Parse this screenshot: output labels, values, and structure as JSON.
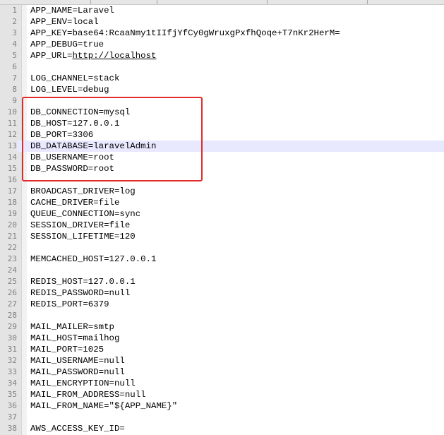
{
  "editor": {
    "lines": [
      {
        "num": "1",
        "text": "APP_NAME=Laravel"
      },
      {
        "num": "2",
        "text": "APP_ENV=local"
      },
      {
        "num": "3",
        "text": "APP_KEY=base64:RcaaNmy1tIIfjYfCy0gWruxgPxfhQoqe+T7nKr2HerM="
      },
      {
        "num": "4",
        "text": "APP_DEBUG=true"
      },
      {
        "num": "5",
        "text": "APP_URL=",
        "link": "http://localhost"
      },
      {
        "num": "6",
        "text": ""
      },
      {
        "num": "7",
        "text": "LOG_CHANNEL=stack"
      },
      {
        "num": "8",
        "text": "LOG_LEVEL=debug"
      },
      {
        "num": "9",
        "text": ""
      },
      {
        "num": "10",
        "text": "DB_CONNECTION=mysql"
      },
      {
        "num": "11",
        "text": "DB_HOST=127.0.0.1"
      },
      {
        "num": "12",
        "text": "DB_PORT=3306"
      },
      {
        "num": "13",
        "text": "DB_DATABASE=laravelAdmin",
        "current": true
      },
      {
        "num": "14",
        "text": "DB_USERNAME=root"
      },
      {
        "num": "15",
        "text": "DB_PASSWORD=root"
      },
      {
        "num": "16",
        "text": ""
      },
      {
        "num": "17",
        "text": "BROADCAST_DRIVER=log"
      },
      {
        "num": "18",
        "text": "CACHE_DRIVER=file"
      },
      {
        "num": "19",
        "text": "QUEUE_CONNECTION=sync"
      },
      {
        "num": "20",
        "text": "SESSION_DRIVER=file"
      },
      {
        "num": "21",
        "text": "SESSION_LIFETIME=120"
      },
      {
        "num": "22",
        "text": ""
      },
      {
        "num": "23",
        "text": "MEMCACHED_HOST=127.0.0.1"
      },
      {
        "num": "24",
        "text": ""
      },
      {
        "num": "25",
        "text": "REDIS_HOST=127.0.0.1"
      },
      {
        "num": "26",
        "text": "REDIS_PASSWORD=null"
      },
      {
        "num": "27",
        "text": "REDIS_PORT=6379"
      },
      {
        "num": "28",
        "text": ""
      },
      {
        "num": "29",
        "text": "MAIL_MAILER=smtp"
      },
      {
        "num": "30",
        "text": "MAIL_HOST=mailhog"
      },
      {
        "num": "31",
        "text": "MAIL_PORT=1025"
      },
      {
        "num": "32",
        "text": "MAIL_USERNAME=null"
      },
      {
        "num": "33",
        "text": "MAIL_PASSWORD=null"
      },
      {
        "num": "34",
        "text": "MAIL_ENCRYPTION=null"
      },
      {
        "num": "35",
        "text": "MAIL_FROM_ADDRESS=null"
      },
      {
        "num": "36",
        "text": "MAIL_FROM_NAME=\"${APP_NAME}\""
      },
      {
        "num": "37",
        "text": ""
      },
      {
        "num": "38",
        "text": "AWS_ACCESS_KEY_ID="
      }
    ]
  },
  "colors": {
    "highlight_box": "#e32a2a",
    "current_line": "#e8e8ff",
    "gutter": "#e4e4e4",
    "line_number": "#808080"
  }
}
